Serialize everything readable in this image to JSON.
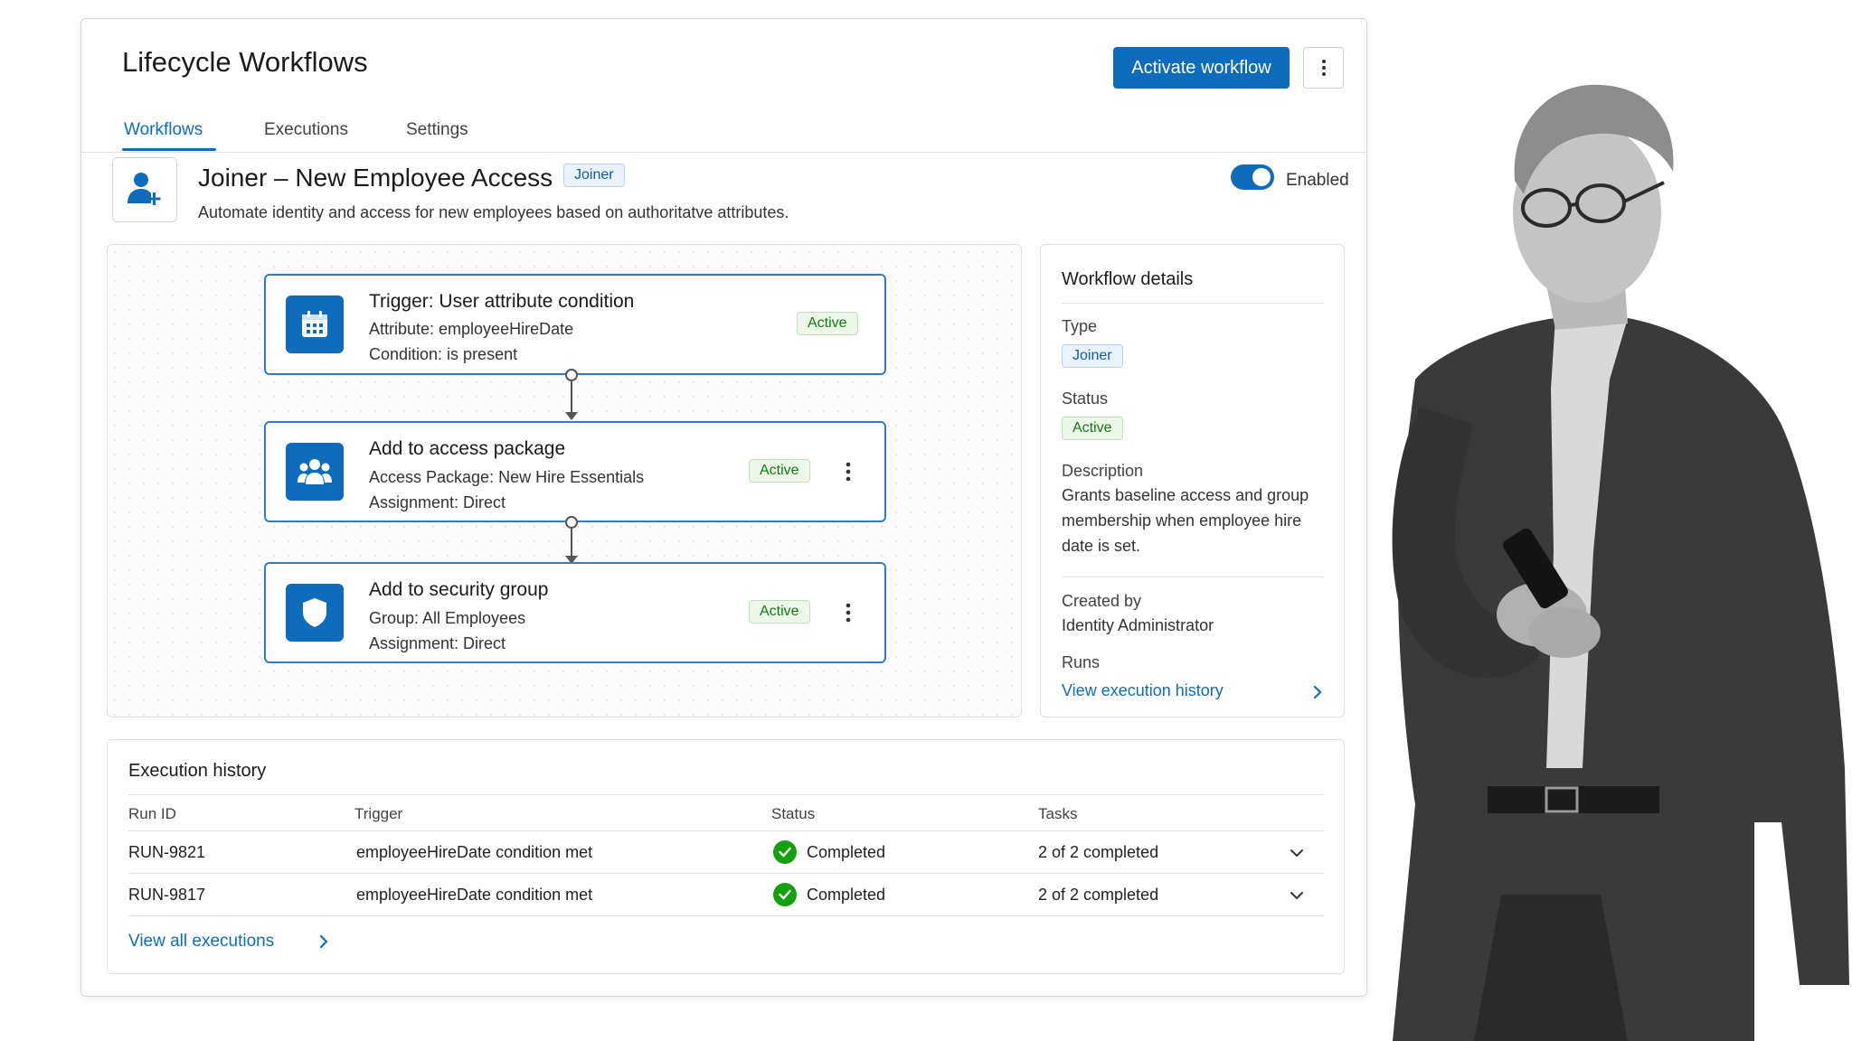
{
  "app": {
    "title": "Lifecycle Workflows",
    "primary_action": "Activate workflow",
    "tabs": [
      {
        "label": "Workflows",
        "active": true
      },
      {
        "label": "Executions",
        "active": false
      },
      {
        "label": "Settings",
        "active": false
      }
    ]
  },
  "workflow": {
    "icon": "person-add-icon",
    "title": "Joiner – New Employee Access",
    "badge": "Joiner",
    "description": "Automate identity and access for new employees based on authoritatve attributes.",
    "enabled": true,
    "enabled_label": "Enabled"
  },
  "steps": [
    {
      "icon": "calendar-icon",
      "title": "Trigger: User attribute condition",
      "line1": "Attribute: employeeHireDate",
      "line2": "Condition: is present",
      "status": "Active"
    },
    {
      "icon": "people-icon",
      "title": "Add to access package",
      "line1": "Access Package: New Hire Essentials",
      "line2": "Assignment: Direct",
      "status": "Active"
    },
    {
      "icon": "shield-icon",
      "title": "Add to security group",
      "line1": "Group: All Employees",
      "line2": "Assignment: Direct",
      "status": "Active"
    }
  ],
  "details": {
    "heading": "Workflow details",
    "type_label": "Type",
    "type_value": "Joiner",
    "status_label": "Status",
    "status_value": "Active",
    "description_label": "Description",
    "description_value": "Grants baseline access and group membership when employee hire date is set.",
    "created_by_label": "Created by",
    "created_by_value": "Identity Administrator",
    "runs_label": "Runs",
    "runs_link": "View execution history"
  },
  "history": {
    "heading": "Execution history",
    "columns": [
      "Run ID",
      "Trigger",
      "Status",
      "Tasks"
    ],
    "rows": [
      {
        "run_id": "RUN-9821",
        "trigger": "employeeHireDate condition met",
        "status": "Completed",
        "tasks": "2 of 2 completed"
      },
      {
        "run_id": "RUN-9817",
        "trigger": "employeeHireDate condition met",
        "status": "Completed",
        "tasks": "2 of 2 completed"
      }
    ],
    "view_all": "View all executions"
  },
  "colors": {
    "accent": "#0f6cbd",
    "success": "#13a10e",
    "active_badge": "#107c10"
  }
}
